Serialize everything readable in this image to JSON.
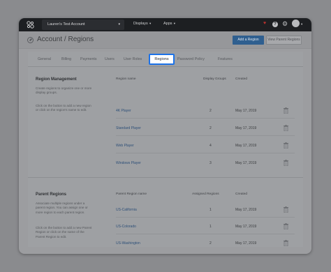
{
  "topbar": {
    "account": "Lauren's Test Account",
    "nav": [
      {
        "label": "Displays"
      },
      {
        "label": "Apps"
      }
    ]
  },
  "header": {
    "title": "Account / Regions",
    "add_button": "Add a Region",
    "view_parent_button": "View Parent Regions"
  },
  "tabs": [
    {
      "label": "General"
    },
    {
      "label": "Billing"
    },
    {
      "label": "Payments"
    },
    {
      "label": "Users"
    },
    {
      "label": "User Roles"
    },
    {
      "label": "Regions",
      "active": true
    },
    {
      "label": "Password Policy"
    },
    {
      "label": "Features"
    }
  ],
  "region_management": {
    "title": "Region Management",
    "desc1": "Create regions to organize one or more display groups.",
    "desc2": "Click on the button to add a new region or click on the region's name to edit.",
    "columns": [
      "Region name",
      "Display Groups",
      "Created"
    ],
    "rows": [
      {
        "name": "4K Player",
        "groups": "2",
        "created": "May 17, 2019"
      },
      {
        "name": "Standard Player",
        "groups": "2",
        "created": "May 17, 2019"
      },
      {
        "name": "Web Player",
        "groups": "4",
        "created": "May 17, 2019"
      },
      {
        "name": "Windows Player",
        "groups": "3",
        "created": "May 17, 2019"
      }
    ]
  },
  "parent_regions": {
    "title": "Parent Regions",
    "desc1": "Associate multiple regions under a parent region. You can assign one or more region to each parent region.",
    "desc2": "Click on the button to add a new Parent Region or click on the name of the Parent Region to edit.",
    "columns": [
      "Parent Region name",
      "Assigned Regions",
      "Created"
    ],
    "rows": [
      {
        "name": "US-California",
        "assigned": "1",
        "created": "May 17, 2019"
      },
      {
        "name": "US-Colorado",
        "assigned": "1",
        "created": "May 17, 2019"
      },
      {
        "name": "US-Washington",
        "assigned": "2",
        "created": "May 17, 2019"
      }
    ]
  },
  "icons": {
    "logo": "logo-icon",
    "trash": "trash-icon",
    "favorite": "heart-icon",
    "help": "help-icon",
    "settings": "gear-icon"
  },
  "colors": {
    "active_tab_outline": "#1c72e8",
    "primary_button": "#2f5f8f",
    "link": "#2d4f78"
  }
}
